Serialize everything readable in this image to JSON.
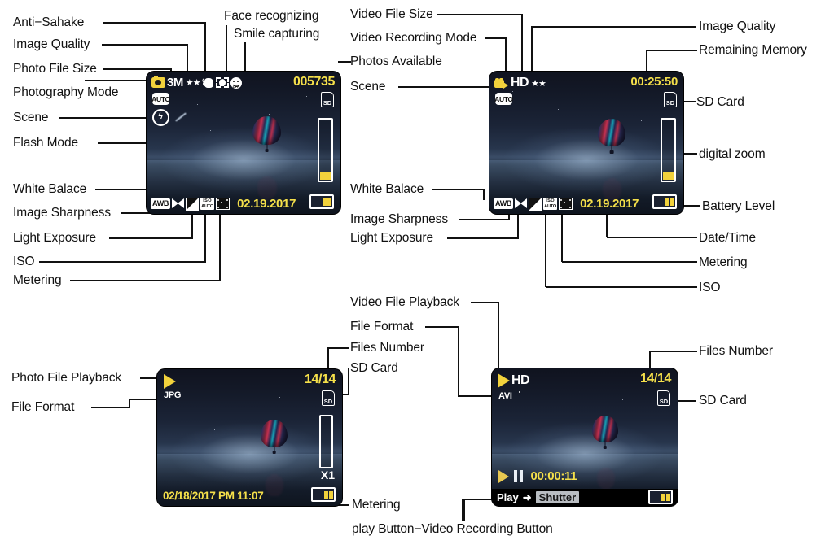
{
  "title": "Digital Camera LCD Screen Icon Guide",
  "labels_left_top": [
    {
      "name": "anti-shake",
      "text": "Anti−Sahake"
    },
    {
      "name": "image-quality",
      "text": "Image Quality"
    },
    {
      "name": "photo-file-size",
      "text": "Photo File Size"
    },
    {
      "name": "photography-mode",
      "text": "Photography Mode"
    },
    {
      "name": "scene",
      "text": "Scene"
    },
    {
      "name": "flash-mode",
      "text": "Flash Mode"
    }
  ],
  "labels_top_center": [
    {
      "name": "face-recognizing",
      "text": "Face  recognizing"
    },
    {
      "name": "smile-capturing",
      "text": "Smile capturing"
    }
  ],
  "labels_left_mid": [
    {
      "name": "white-balance",
      "text": "White Balace"
    },
    {
      "name": "image-sharpness",
      "text": "Image Sharpness"
    },
    {
      "name": "light-exposure",
      "text": "Light Exposure"
    },
    {
      "name": "iso",
      "text": "ISO"
    },
    {
      "name": "metering",
      "text": "Metering"
    }
  ],
  "labels_center_top": [
    {
      "name": "video-file-size",
      "text": "Video File Size"
    },
    {
      "name": "video-recording-mode",
      "text": "Video Recording Mode"
    },
    {
      "name": "photos-available",
      "text": "Photos Available"
    },
    {
      "name": "scene-2",
      "text": "Scene"
    }
  ],
  "labels_center_mid": [
    {
      "name": "white-balance-2",
      "text": "White Balace"
    },
    {
      "name": "image-sharpness-2",
      "text": "Image Sharpness"
    },
    {
      "name": "light-exposure-2",
      "text": "Light Exposure"
    }
  ],
  "labels_right_top": [
    {
      "name": "image-quality-2",
      "text": "Image Quality"
    },
    {
      "name": "remaining-memory",
      "text": "Remaining Memory"
    },
    {
      "name": "sd-card-2",
      "text": "SD Card"
    },
    {
      "name": "digital-zoom",
      "text": "digital zoom"
    },
    {
      "name": "battery-level",
      "text": "Battery Level"
    },
    {
      "name": "date-time",
      "text": "Date/Time"
    },
    {
      "name": "metering-2",
      "text": "Metering"
    },
    {
      "name": "iso-2",
      "text": "ISO"
    }
  ],
  "labels_bottom_center": [
    {
      "name": "video-file-playback",
      "text": "Video File Playback"
    },
    {
      "name": "file-format-2",
      "text": "File Format"
    },
    {
      "name": "files-number",
      "text": "Files Number"
    },
    {
      "name": "sd-card-3",
      "text": "SD Card"
    }
  ],
  "labels_bottom_left": [
    {
      "name": "photo-file-playback",
      "text": "Photo File Playback"
    },
    {
      "name": "file-format",
      "text": "File Format"
    }
  ],
  "labels_bottom_right": [
    {
      "name": "files-number-2",
      "text": "Files Number"
    },
    {
      "name": "sd-card-4",
      "text": "SD Card"
    },
    {
      "name": "metering-3",
      "text": "Metering"
    },
    {
      "name": "play-record-button",
      "text": "play Button−Video  Recording Button"
    }
  ],
  "screens": {
    "photo_capture": {
      "name": "photo-capture-screen",
      "file_size": "3M",
      "quality_stars": "★★",
      "photos_available": "005735",
      "scene_badge": "AUTO",
      "sd_label": "SD",
      "white_balance": "AWB",
      "iso_line1": "ISO",
      "iso_line2": "AUTO",
      "date": "02.19.2017"
    },
    "video_capture": {
      "name": "video-capture-screen",
      "mode": "HD",
      "quality_stars": "★★",
      "remaining_memory": "00:25:50",
      "scene_badge": "AUTO",
      "sd_label": "SD",
      "white_balance": "AWB",
      "iso_line1": "ISO",
      "iso_line2": "AUTO",
      "date": "02.19.2017"
    },
    "photo_playback": {
      "name": "photo-playback-screen",
      "file_format": "JPG",
      "files_number": "14/14",
      "sd_label": "SD",
      "zoom": "X1",
      "datetime": "02/18/2017  PM  11:07"
    },
    "video_playback": {
      "name": "video-playback-screen",
      "mode": "HD",
      "file_format": "AVI",
      "files_number": "14/14",
      "sd_label": "SD",
      "elapsed": "00:00:11",
      "bar_play": "Play",
      "bar_arrow": "➜",
      "bar_shutter": "Shutter"
    }
  },
  "colors": {
    "osd_yellow": "#f5e04a",
    "osd_white": "#ffffff",
    "screen_bg": "#0a0d17",
    "line": "#111111"
  }
}
